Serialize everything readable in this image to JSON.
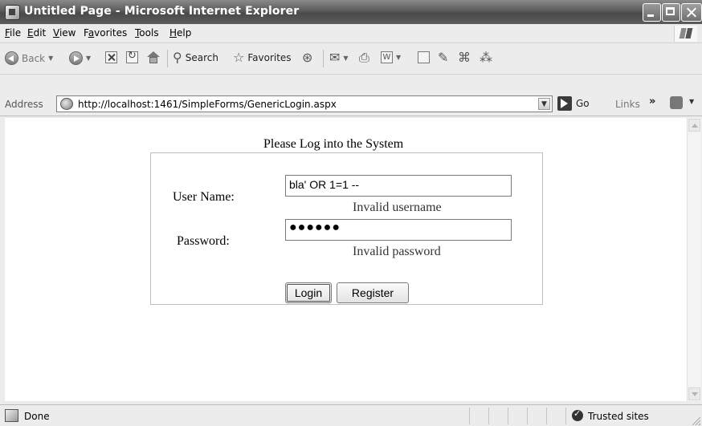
{
  "window": {
    "title": "Untitled Page - Microsoft Internet Explorer"
  },
  "menu": {
    "items": [
      {
        "key": "F",
        "rest": "ile"
      },
      {
        "key": "E",
        "rest": "dit"
      },
      {
        "key": "V",
        "rest": "iew"
      },
      {
        "pre": "F",
        "key": "a",
        "rest": "vorites"
      },
      {
        "key": "T",
        "rest": "ools"
      },
      {
        "key": "H",
        "rest": "elp"
      }
    ]
  },
  "toolbar": {
    "back_label": "Back",
    "search_label": "Search",
    "favorites_label": "Favorites"
  },
  "address": {
    "label": "Address",
    "url": "http://localhost:1461/SimpleForms/GenericLogin.aspx",
    "go_label": "Go",
    "links_label": "Links"
  },
  "page": {
    "heading": "Please Log into the System",
    "username_label": "User Name:",
    "username_value": "bla' OR 1=1 --",
    "username_error": "Invalid username",
    "password_label": "Password:",
    "password_value": "●●●●●●",
    "password_error": "Invalid password",
    "login_button": "Login",
    "register_button": "Register"
  },
  "status": {
    "text": "Done",
    "zone": "Trusted sites"
  }
}
